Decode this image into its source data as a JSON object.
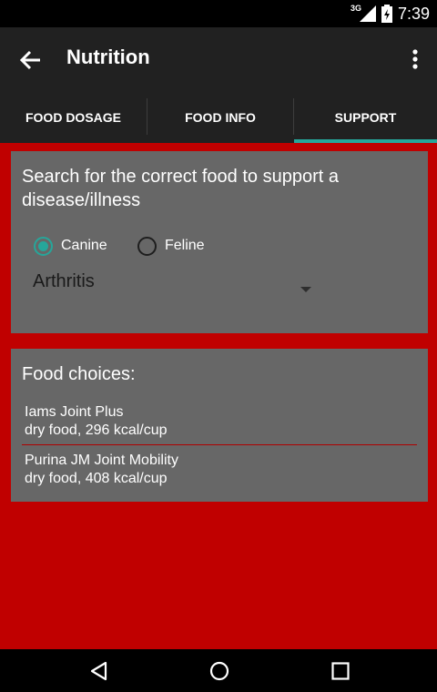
{
  "status": {
    "network": "3G",
    "time": "7:39"
  },
  "app_bar": {
    "title": "Nutrition",
    "back_icon": "arrow-left-icon",
    "menu_icon": "overflow-menu-icon"
  },
  "tabs": [
    {
      "label": "FOOD DOSAGE",
      "selected": false
    },
    {
      "label": "FOOD INFO",
      "selected": false
    },
    {
      "label": "SUPPORT",
      "selected": true
    }
  ],
  "search_card": {
    "prompt": "Search for the correct food to support a disease/illness",
    "species": [
      {
        "label": "Canine",
        "selected": true
      },
      {
        "label": "Feline",
        "selected": false
      }
    ],
    "condition": "Arthritis"
  },
  "food_choices": {
    "title": "Food choices:",
    "items": [
      {
        "name": "Iams Joint Plus",
        "detail": "dry food, 296 kcal/cup"
      },
      {
        "name": "Purina JM Joint Mobility",
        "detail": "dry food, 408 kcal/cup"
      }
    ]
  },
  "colors": {
    "background": "#c00000",
    "card": "#676767",
    "app_bar": "#212121",
    "accent": "#26a69a"
  },
  "nav": {
    "back_icon": "nav-back-icon",
    "home_icon": "nav-home-icon",
    "recents_icon": "nav-recents-icon"
  }
}
